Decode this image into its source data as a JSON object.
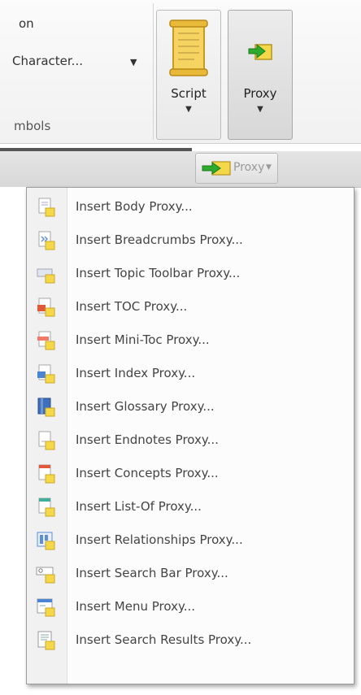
{
  "ribbon": {
    "partial_top_text": "on",
    "character_dropdown": "Character...",
    "symbols_group_label": "mbols",
    "script_button": "Script",
    "proxy_button": "Proxy"
  },
  "proxy_mini_button": "Proxy",
  "menu": {
    "items": [
      {
        "label": "Insert Body Proxy...",
        "icon": "body-proxy-icon"
      },
      {
        "label": "Insert Breadcrumbs Proxy...",
        "icon": "breadcrumbs-proxy-icon"
      },
      {
        "label": "Insert Topic Toolbar Proxy...",
        "icon": "topic-toolbar-proxy-icon"
      },
      {
        "label": "Insert TOC Proxy...",
        "icon": "toc-proxy-icon"
      },
      {
        "label": "Insert Mini-Toc Proxy...",
        "icon": "mini-toc-proxy-icon"
      },
      {
        "label": "Insert Index Proxy...",
        "icon": "index-proxy-icon"
      },
      {
        "label": "Insert Glossary Proxy...",
        "icon": "glossary-proxy-icon"
      },
      {
        "label": "Insert Endnotes Proxy...",
        "icon": "endnotes-proxy-icon"
      },
      {
        "label": "Insert Concepts Proxy...",
        "icon": "concepts-proxy-icon"
      },
      {
        "label": "Insert List-Of Proxy...",
        "icon": "list-of-proxy-icon"
      },
      {
        "label": "Insert Relationships Proxy...",
        "icon": "relationships-proxy-icon"
      },
      {
        "label": "Insert Search Bar Proxy...",
        "icon": "search-bar-proxy-icon"
      },
      {
        "label": "Insert Menu Proxy...",
        "icon": "menu-proxy-icon"
      },
      {
        "label": "Insert Search Results Proxy...",
        "icon": "search-results-proxy-icon"
      }
    ]
  },
  "colors": {
    "menu_background": "#fcfcfc",
    "gutter": "#f1f1f1",
    "proxy_arrow_green": "#2eaa2e",
    "proxy_doc_yellow": "#f5d84a"
  }
}
